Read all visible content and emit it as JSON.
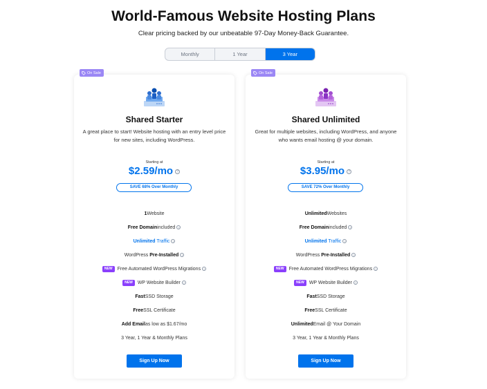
{
  "header": {
    "title": "World-Famous Website Hosting Plans",
    "subtitle": "Clear pricing backed by our unbeatable 97-Day Money-Back Guarantee."
  },
  "billing_toggle": {
    "options": [
      "Monthly",
      "1 Year",
      "3 Year"
    ],
    "selected": "3 Year"
  },
  "colors": {
    "accent": "#0073ec",
    "badge": "#9b87f5",
    "new_tag": "#8a3ffc"
  },
  "plans": [
    {
      "badge": "On Sale",
      "icon": "users-network-icon-blue",
      "name": "Shared Starter",
      "desc": "A great place to start! Website hosting with an entry level price for new sites, including WordPress.",
      "starting_label": "Starting at",
      "price": "$2.59/mo",
      "save": "SAVE 68% Over Monthly",
      "features": {
        "f1_bold": "1",
        "f1_rest": " Website",
        "f2_bold": "Free Domain",
        "f2_rest": " included",
        "f3_bold": "Unlimited",
        "f3_rest": " Traffic",
        "f4_pre": "WordPress ",
        "f4_bold": "Pre-Installed",
        "f5_new": "NEW",
        "f5_text": "Free Automated WordPress Migrations",
        "f6_new": "NEW",
        "f6_text": "WP Website Builder",
        "f7_bold": "Fast",
        "f7_rest": " SSD Storage",
        "f8_bold": "Free",
        "f8_rest": " SSL Certificate",
        "f9_bold": "Add Email",
        "f9_rest": " as low as $1.67/mo",
        "f10_text": "3 Year, 1 Year & Monthly Plans"
      },
      "cta": "Sign Up Now"
    },
    {
      "badge": "On Sale",
      "icon": "users-network-icon-purple",
      "name": "Shared Unlimited",
      "desc": "Great for multiple websites, including WordPress, and anyone who wants email hosting @ your domain.",
      "starting_label": "Starting at",
      "price": "$3.95/mo",
      "save": "SAVE 72% Over Monthly",
      "features": {
        "f1_bold": "Unlimited",
        "f1_rest": " Websites",
        "f2_bold": "Free Domain",
        "f2_rest": " included",
        "f3_bold": "Unlimited",
        "f3_rest": " Traffic",
        "f4_pre": "WordPress ",
        "f4_bold": "Pre-Installed",
        "f5_new": "NEW",
        "f5_text": "Free Automated WordPress Migrations",
        "f6_new": "NEW",
        "f6_text": "WP Website Builder",
        "f7_bold": "Fast",
        "f7_rest": " SSD Storage",
        "f8_bold": "Free",
        "f8_rest": " SSL Certificate",
        "f9_bold": "Unlimited",
        "f9_rest": " Email @ Your Domain",
        "f10_text": "3 Year, 1 Year & Monthly Plans"
      },
      "cta": "Sign Up Now"
    }
  ]
}
